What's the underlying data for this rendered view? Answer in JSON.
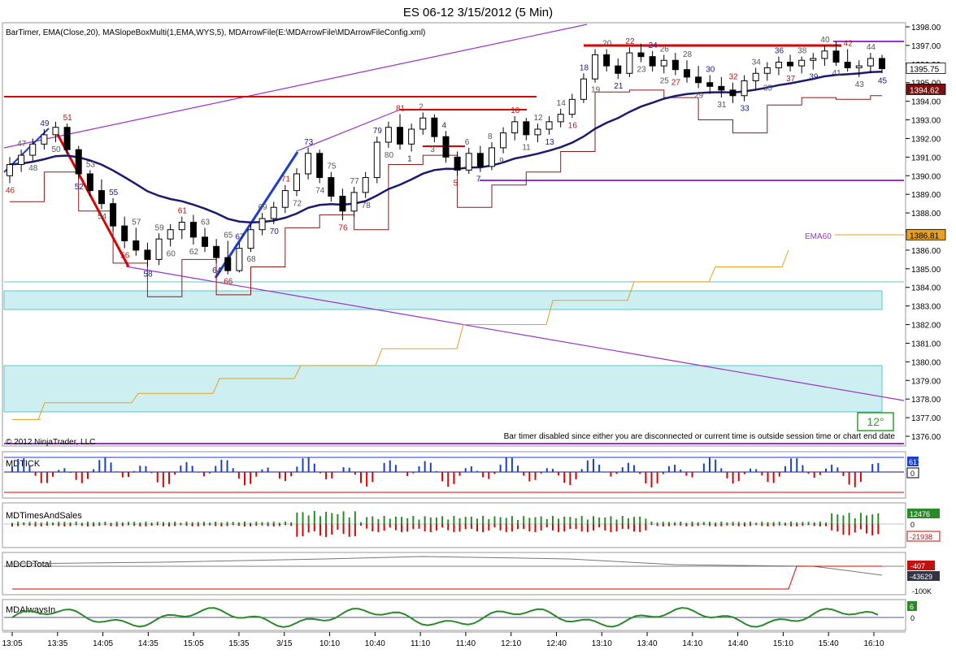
{
  "title": "ES 06-12  3/15/2012 (5 Min)",
  "indicator_line": "BarTimer, EMA(Close,20), MASlopeBoxMulti(1,EMA,WYS,5), MDArrowFile(E:\\MDArrowFile\\MDArrowFileConfig.xml)",
  "copyright": "© 2012 NinjaTrader, LLC",
  "bar_timer_message": "Bar timer disabled since either you are disconnected or current time is outside session time or chart end date",
  "angle_label": "12°",
  "ema60_label": "EMA60",
  "colors": {
    "up_bar": "#ffffff",
    "down_bar": "#000000",
    "ema20": "#1a1a6e",
    "red_level": "#e00000",
    "channel": "#9933cc",
    "ema60": "#e8a020",
    "cyan_zone": "#cdeff2"
  },
  "chart_data": [
    {
      "type": "candlestick",
      "panel": "price",
      "price_axis": {
        "min": 1376.0,
        "max": 1398.0,
        "ticks": [
          "1398.00",
          "1397.00",
          "1396.00",
          "1395.00",
          "1394.00",
          "1393.00",
          "1392.00",
          "1391.00",
          "1390.00",
          "1389.00",
          "1388.00",
          "1387.00",
          "1386.00",
          "1385.00",
          "1384.00",
          "1383.00",
          "1382.00",
          "1381.00",
          "1380.00",
          "1379.00",
          "1378.00",
          "1377.00",
          "1376.00"
        ]
      },
      "time_labels": [
        "13:05",
        "13:35",
        "14:05",
        "14:35",
        "15:05",
        "15:35",
        "3/15",
        "10:10",
        "10:40",
        "11:10",
        "11:40",
        "12:10",
        "12:40",
        "13:10",
        "13:40",
        "14:10",
        "14:40",
        "15:10",
        "15:40",
        "16:10"
      ],
      "price_markers": [
        {
          "label": "1395.75",
          "value": 1395.75,
          "bg": "#ffffff",
          "fg": "#000000"
        },
        {
          "label": "1394.62",
          "value": 1394.62,
          "bg": "#7a1010",
          "fg": "#ffffff"
        },
        {
          "label": "1386.81",
          "value": 1386.81,
          "bg": "#e8a020",
          "fg": "#000000"
        }
      ],
      "ohlc": [
        [
          1390,
          1391,
          1389.6,
          1390.6
        ],
        [
          1390.6,
          1391.4,
          1390.2,
          1391.1
        ],
        [
          1391.1,
          1392,
          1390.8,
          1391.7
        ],
        [
          1391.7,
          1392.5,
          1391.4,
          1392.2
        ],
        [
          1392.2,
          1392.9,
          1391.8,
          1392.6
        ],
        [
          1392.6,
          1392.8,
          1391.2,
          1391.4
        ],
        [
          1391.4,
          1391.6,
          1389.8,
          1390.1
        ],
        [
          1390.1,
          1390.3,
          1388.9,
          1389.2
        ],
        [
          1389.2,
          1389.8,
          1388.2,
          1388.5
        ],
        [
          1388.5,
          1388.8,
          1387,
          1387.3
        ],
        [
          1387.3,
          1387.8,
          1386.1,
          1386.5
        ],
        [
          1386.5,
          1387.2,
          1385.7,
          1386
        ],
        [
          1386,
          1386.4,
          1385.1,
          1385.5
        ],
        [
          1385.5,
          1386.9,
          1385.2,
          1386.6
        ],
        [
          1386.6,
          1387.4,
          1386.2,
          1387.1
        ],
        [
          1387.1,
          1387.8,
          1386.6,
          1387.5
        ],
        [
          1387.5,
          1387.9,
          1386.3,
          1386.7
        ],
        [
          1386.7,
          1387.2,
          1385.9,
          1386.2
        ],
        [
          1386.2,
          1386.6,
          1385.3,
          1385.6
        ],
        [
          1385.6,
          1386.5,
          1384.7,
          1384.9
        ],
        [
          1384.9,
          1386.4,
          1384.8,
          1386.1
        ],
        [
          1386.1,
          1387.4,
          1385.9,
          1387.1
        ],
        [
          1387.1,
          1388,
          1386.8,
          1387.7
        ],
        [
          1387.7,
          1388.6,
          1387.4,
          1388.3
        ],
        [
          1388.3,
          1389.5,
          1388,
          1389.2
        ],
        [
          1389.2,
          1390.4,
          1388.9,
          1390.1
        ],
        [
          1390.1,
          1391.5,
          1389.8,
          1391.2
        ],
        [
          1391.2,
          1391.4,
          1389.6,
          1389.9
        ],
        [
          1389.9,
          1390.2,
          1388.6,
          1388.9
        ],
        [
          1388.9,
          1389.3,
          1387.6,
          1388.1
        ],
        [
          1388.1,
          1389.4,
          1387.8,
          1389.1
        ],
        [
          1389.1,
          1390.2,
          1388.8,
          1389.9
        ],
        [
          1389.9,
          1392.1,
          1389.6,
          1391.8
        ],
        [
          1391.8,
          1392.9,
          1391.5,
          1392.6
        ],
        [
          1392.6,
          1393.3,
          1391.4,
          1391.7
        ],
        [
          1391.7,
          1392.8,
          1391.3,
          1392.5
        ],
        [
          1392.5,
          1393.4,
          1392.2,
          1393.1
        ],
        [
          1393.1,
          1393.3,
          1391.8,
          1392.1
        ],
        [
          1392.1,
          1392.4,
          1390.7,
          1391
        ],
        [
          1391,
          1391.3,
          1390,
          1390.3
        ],
        [
          1390.3,
          1391.5,
          1390.1,
          1391.2
        ],
        [
          1391.2,
          1391.6,
          1390.2,
          1390.5
        ],
        [
          1390.5,
          1391.8,
          1390.3,
          1391.5
        ],
        [
          1391.5,
          1392.6,
          1391.2,
          1392.3
        ],
        [
          1392.3,
          1393.2,
          1391.9,
          1392.9
        ],
        [
          1392.9,
          1393.1,
          1391.9,
          1392.2
        ],
        [
          1392.2,
          1392.8,
          1391.8,
          1392.5
        ],
        [
          1392.5,
          1393.2,
          1392.2,
          1392.9
        ],
        [
          1392.9,
          1393.6,
          1392.6,
          1393.3
        ],
        [
          1393.3,
          1394.4,
          1393.1,
          1394.1
        ],
        [
          1394.1,
          1395.5,
          1393.9,
          1395.2
        ],
        [
          1395.2,
          1396.8,
          1395,
          1396.5
        ],
        [
          1396.5,
          1396.8,
          1395.6,
          1395.9
        ],
        [
          1395.9,
          1396.3,
          1395.2,
          1395.5
        ],
        [
          1395.5,
          1396.9,
          1395.3,
          1396.6
        ],
        [
          1396.6,
          1397.1,
          1396.1,
          1396.4
        ],
        [
          1396.4,
          1396.7,
          1395.6,
          1395.9
        ],
        [
          1395.9,
          1396.5,
          1395.5,
          1396.2
        ],
        [
          1396.2,
          1396.6,
          1395.4,
          1395.7
        ],
        [
          1395.7,
          1396.2,
          1395,
          1395.3
        ],
        [
          1395.3,
          1395.9,
          1394.7,
          1395
        ],
        [
          1395,
          1395.4,
          1394.4,
          1394.8
        ],
        [
          1394.8,
          1395.3,
          1394.2,
          1394.6
        ],
        [
          1394.6,
          1395,
          1393.9,
          1394.3
        ],
        [
          1394.3,
          1395.4,
          1394,
          1395.1
        ],
        [
          1395.1,
          1395.8,
          1394.6,
          1395.5
        ],
        [
          1395.5,
          1396.1,
          1395.1,
          1395.8
        ],
        [
          1395.8,
          1396.4,
          1395.4,
          1396.1
        ],
        [
          1396.1,
          1396.5,
          1395.6,
          1395.9
        ],
        [
          1395.9,
          1396.4,
          1395.5,
          1396.2
        ],
        [
          1396.2,
          1396.6,
          1395.7,
          1396.3
        ],
        [
          1396.3,
          1397,
          1395.9,
          1396.7
        ],
        [
          1396.7,
          1397.2,
          1395.9,
          1396.1
        ],
        [
          1396.1,
          1396.8,
          1395.6,
          1395.8
        ],
        [
          1395.8,
          1396.2,
          1395.3,
          1395.9
        ],
        [
          1395.9,
          1396.6,
          1395.5,
          1396.3
        ],
        [
          1396.3,
          1396.5,
          1395.5,
          1395.75
        ]
      ],
      "count_labels": [
        "46",
        "47",
        "48",
        "49",
        "50",
        "51",
        "52",
        "53",
        "54",
        "55",
        "56",
        "57",
        "58",
        "59",
        "60",
        "61",
        "62",
        "63",
        "64",
        "65",
        "66",
        "67",
        "68",
        "69",
        "70",
        "71",
        "72",
        "73",
        "74",
        "75",
        "76",
        "77",
        "78",
        "79",
        "80",
        "81",
        "1",
        "2",
        "3",
        "4",
        "5",
        "6",
        "7",
        "8",
        "9",
        "10",
        "11",
        "12",
        "13",
        "14",
        "16",
        "18",
        "19",
        "20",
        "21",
        "22",
        "23",
        "24",
        "25",
        "26",
        "27",
        "28",
        "29",
        "30",
        "31",
        "32",
        "33",
        "34",
        "35",
        "36",
        "37",
        "38",
        "39",
        "40",
        "41",
        "42",
        "43",
        "44",
        "45"
      ]
    },
    {
      "type": "bar",
      "panel": "MDTICK",
      "name": "MDTICK",
      "markers": [
        "617",
        "0"
      ]
    },
    {
      "type": "bar",
      "panel": "MDTimesAndSales",
      "name": "MDTimesAndSales",
      "markers": [
        "12476",
        "0",
        "-21938"
      ]
    },
    {
      "type": "line",
      "panel": "MDCDTotal",
      "name": "MDCDTotal",
      "markers": [
        "-407",
        "-43629",
        "-100K"
      ]
    },
    {
      "type": "line",
      "panel": "MDAlwaysIn",
      "name": "MDAlwaysIn",
      "markers": [
        "6",
        "0"
      ]
    }
  ]
}
